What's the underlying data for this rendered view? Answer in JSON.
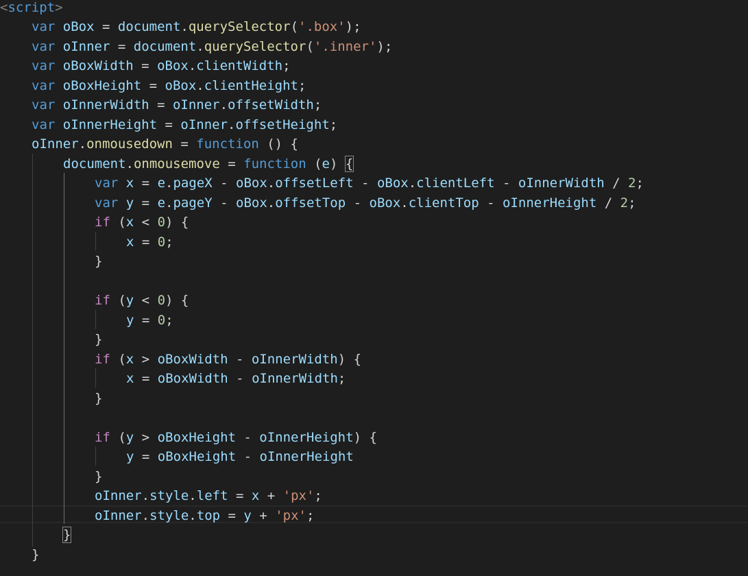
{
  "editor": {
    "theme": {
      "background": "#1e1e1e",
      "default": "#d4d4d4",
      "keyword": "#569cd6",
      "control": "#c586c0",
      "variable": "#9cdcfe",
      "function": "#dcdcaa",
      "string": "#ce9178",
      "number": "#b5cea8"
    },
    "lines": [
      [
        [
          "tagb",
          "<"
        ],
        [
          "tag",
          "script"
        ],
        [
          "tagb",
          ">"
        ]
      ],
      [
        [
          "kw",
          "var"
        ],
        [
          "p",
          " "
        ],
        [
          "var",
          "oBox"
        ],
        [
          "p",
          " = "
        ],
        [
          "var",
          "document"
        ],
        [
          "p",
          "."
        ],
        [
          "fn",
          "querySelector"
        ],
        [
          "p",
          "("
        ],
        [
          "str",
          "'.box'"
        ],
        [
          "p",
          ");"
        ]
      ],
      [
        [
          "kw",
          "var"
        ],
        [
          "p",
          " "
        ],
        [
          "var",
          "oInner"
        ],
        [
          "p",
          " = "
        ],
        [
          "var",
          "document"
        ],
        [
          "p",
          "."
        ],
        [
          "fn",
          "querySelector"
        ],
        [
          "p",
          "("
        ],
        [
          "str",
          "'.inner'"
        ],
        [
          "p",
          ");"
        ]
      ],
      [
        [
          "kw",
          "var"
        ],
        [
          "p",
          " "
        ],
        [
          "var",
          "oBoxWidth"
        ],
        [
          "p",
          " = "
        ],
        [
          "var",
          "oBox"
        ],
        [
          "p",
          "."
        ],
        [
          "var",
          "clientWidth"
        ],
        [
          "p",
          ";"
        ]
      ],
      [
        [
          "kw",
          "var"
        ],
        [
          "p",
          " "
        ],
        [
          "var",
          "oBoxHeight"
        ],
        [
          "p",
          " = "
        ],
        [
          "var",
          "oBox"
        ],
        [
          "p",
          "."
        ],
        [
          "var",
          "clientHeight"
        ],
        [
          "p",
          ";"
        ]
      ],
      [
        [
          "kw",
          "var"
        ],
        [
          "p",
          " "
        ],
        [
          "var",
          "oInnerWidth"
        ],
        [
          "p",
          " = "
        ],
        [
          "var",
          "oInner"
        ],
        [
          "p",
          "."
        ],
        [
          "var",
          "offsetWidth"
        ],
        [
          "p",
          ";"
        ]
      ],
      [
        [
          "kw",
          "var"
        ],
        [
          "p",
          " "
        ],
        [
          "var",
          "oInnerHeight"
        ],
        [
          "p",
          " = "
        ],
        [
          "var",
          "oInner"
        ],
        [
          "p",
          "."
        ],
        [
          "var",
          "offsetHeight"
        ],
        [
          "p",
          ";"
        ]
      ],
      [
        [
          "var",
          "oInner"
        ],
        [
          "p",
          "."
        ],
        [
          "fn",
          "onmousedown"
        ],
        [
          "p",
          " = "
        ],
        [
          "kw",
          "function"
        ],
        [
          "p",
          " () {"
        ]
      ],
      [
        [
          "var",
          "document"
        ],
        [
          "p",
          "."
        ],
        [
          "fn",
          "onmousemove"
        ],
        [
          "p",
          " = "
        ],
        [
          "kw",
          "function"
        ],
        [
          "p",
          " ("
        ],
        [
          "var",
          "e"
        ],
        [
          "p",
          ") "
        ],
        [
          "pb",
          "{"
        ]
      ],
      [
        [
          "kw",
          "var"
        ],
        [
          "p",
          " "
        ],
        [
          "var",
          "x"
        ],
        [
          "p",
          " = "
        ],
        [
          "var",
          "e"
        ],
        [
          "p",
          "."
        ],
        [
          "var",
          "pageX"
        ],
        [
          "p",
          " - "
        ],
        [
          "var",
          "oBox"
        ],
        [
          "p",
          "."
        ],
        [
          "var",
          "offsetLeft"
        ],
        [
          "p",
          " - "
        ],
        [
          "var",
          "oBox"
        ],
        [
          "p",
          "."
        ],
        [
          "var",
          "clientLeft"
        ],
        [
          "p",
          " - "
        ],
        [
          "var",
          "oInnerWidth"
        ],
        [
          "p",
          " / "
        ],
        [
          "num",
          "2"
        ],
        [
          "p",
          ";"
        ]
      ],
      [
        [
          "kw",
          "var"
        ],
        [
          "p",
          " "
        ],
        [
          "var",
          "y"
        ],
        [
          "p",
          " = "
        ],
        [
          "var",
          "e"
        ],
        [
          "p",
          "."
        ],
        [
          "var",
          "pageY"
        ],
        [
          "p",
          " - "
        ],
        [
          "var",
          "oBox"
        ],
        [
          "p",
          "."
        ],
        [
          "var",
          "offsetTop"
        ],
        [
          "p",
          " - "
        ],
        [
          "var",
          "oBox"
        ],
        [
          "p",
          "."
        ],
        [
          "var",
          "clientTop"
        ],
        [
          "p",
          " - "
        ],
        [
          "var",
          "oInnerHeight"
        ],
        [
          "p",
          " / "
        ],
        [
          "num",
          "2"
        ],
        [
          "p",
          ";"
        ]
      ],
      [
        [
          "ctl",
          "if"
        ],
        [
          "p",
          " ("
        ],
        [
          "var",
          "x"
        ],
        [
          "p",
          " < "
        ],
        [
          "num",
          "0"
        ],
        [
          "p",
          ") {"
        ]
      ],
      [
        [
          "var",
          "x"
        ],
        [
          "p",
          " = "
        ],
        [
          "num",
          "0"
        ],
        [
          "p",
          ";"
        ]
      ],
      [
        [
          "p",
          "}"
        ]
      ],
      [],
      [
        [
          "ctl",
          "if"
        ],
        [
          "p",
          " ("
        ],
        [
          "var",
          "y"
        ],
        [
          "p",
          " < "
        ],
        [
          "num",
          "0"
        ],
        [
          "p",
          ") {"
        ]
      ],
      [
        [
          "var",
          "y"
        ],
        [
          "p",
          " = "
        ],
        [
          "num",
          "0"
        ],
        [
          "p",
          ";"
        ]
      ],
      [
        [
          "p",
          "}"
        ]
      ],
      [
        [
          "ctl",
          "if"
        ],
        [
          "p",
          " ("
        ],
        [
          "var",
          "x"
        ],
        [
          "p",
          " > "
        ],
        [
          "var",
          "oBoxWidth"
        ],
        [
          "p",
          " - "
        ],
        [
          "var",
          "oInnerWidth"
        ],
        [
          "p",
          ") {"
        ]
      ],
      [
        [
          "var",
          "x"
        ],
        [
          "p",
          " = "
        ],
        [
          "var",
          "oBoxWidth"
        ],
        [
          "p",
          " - "
        ],
        [
          "var",
          "oInnerWidth"
        ],
        [
          "p",
          ";"
        ]
      ],
      [
        [
          "p",
          "}"
        ]
      ],
      [],
      [
        [
          "ctl",
          "if"
        ],
        [
          "p",
          " ("
        ],
        [
          "var",
          "y"
        ],
        [
          "p",
          " > "
        ],
        [
          "var",
          "oBoxHeight"
        ],
        [
          "p",
          " - "
        ],
        [
          "var",
          "oInnerHeight"
        ],
        [
          "p",
          ") {"
        ]
      ],
      [
        [
          "var",
          "y"
        ],
        [
          "p",
          " = "
        ],
        [
          "var",
          "oBoxHeight"
        ],
        [
          "p",
          " - "
        ],
        [
          "var",
          "oInnerHeight"
        ]
      ],
      [
        [
          "p",
          "}"
        ]
      ],
      [
        [
          "var",
          "oInner"
        ],
        [
          "p",
          "."
        ],
        [
          "var",
          "style"
        ],
        [
          "p",
          "."
        ],
        [
          "var",
          "left"
        ],
        [
          "p",
          " = "
        ],
        [
          "var",
          "x"
        ],
        [
          "p",
          " + "
        ],
        [
          "str",
          "'px'"
        ],
        [
          "p",
          ";"
        ]
      ],
      [
        [
          "var",
          "oInner"
        ],
        [
          "p",
          "."
        ],
        [
          "var",
          "style"
        ],
        [
          "p",
          "."
        ],
        [
          "var",
          "top"
        ],
        [
          "p",
          " = "
        ],
        [
          "var",
          "y"
        ],
        [
          "p",
          " + "
        ],
        [
          "str",
          "'px'"
        ],
        [
          "p",
          ";"
        ]
      ],
      [
        [
          "pb",
          "}"
        ]
      ],
      [
        [
          "p",
          "}"
        ]
      ]
    ]
  }
}
